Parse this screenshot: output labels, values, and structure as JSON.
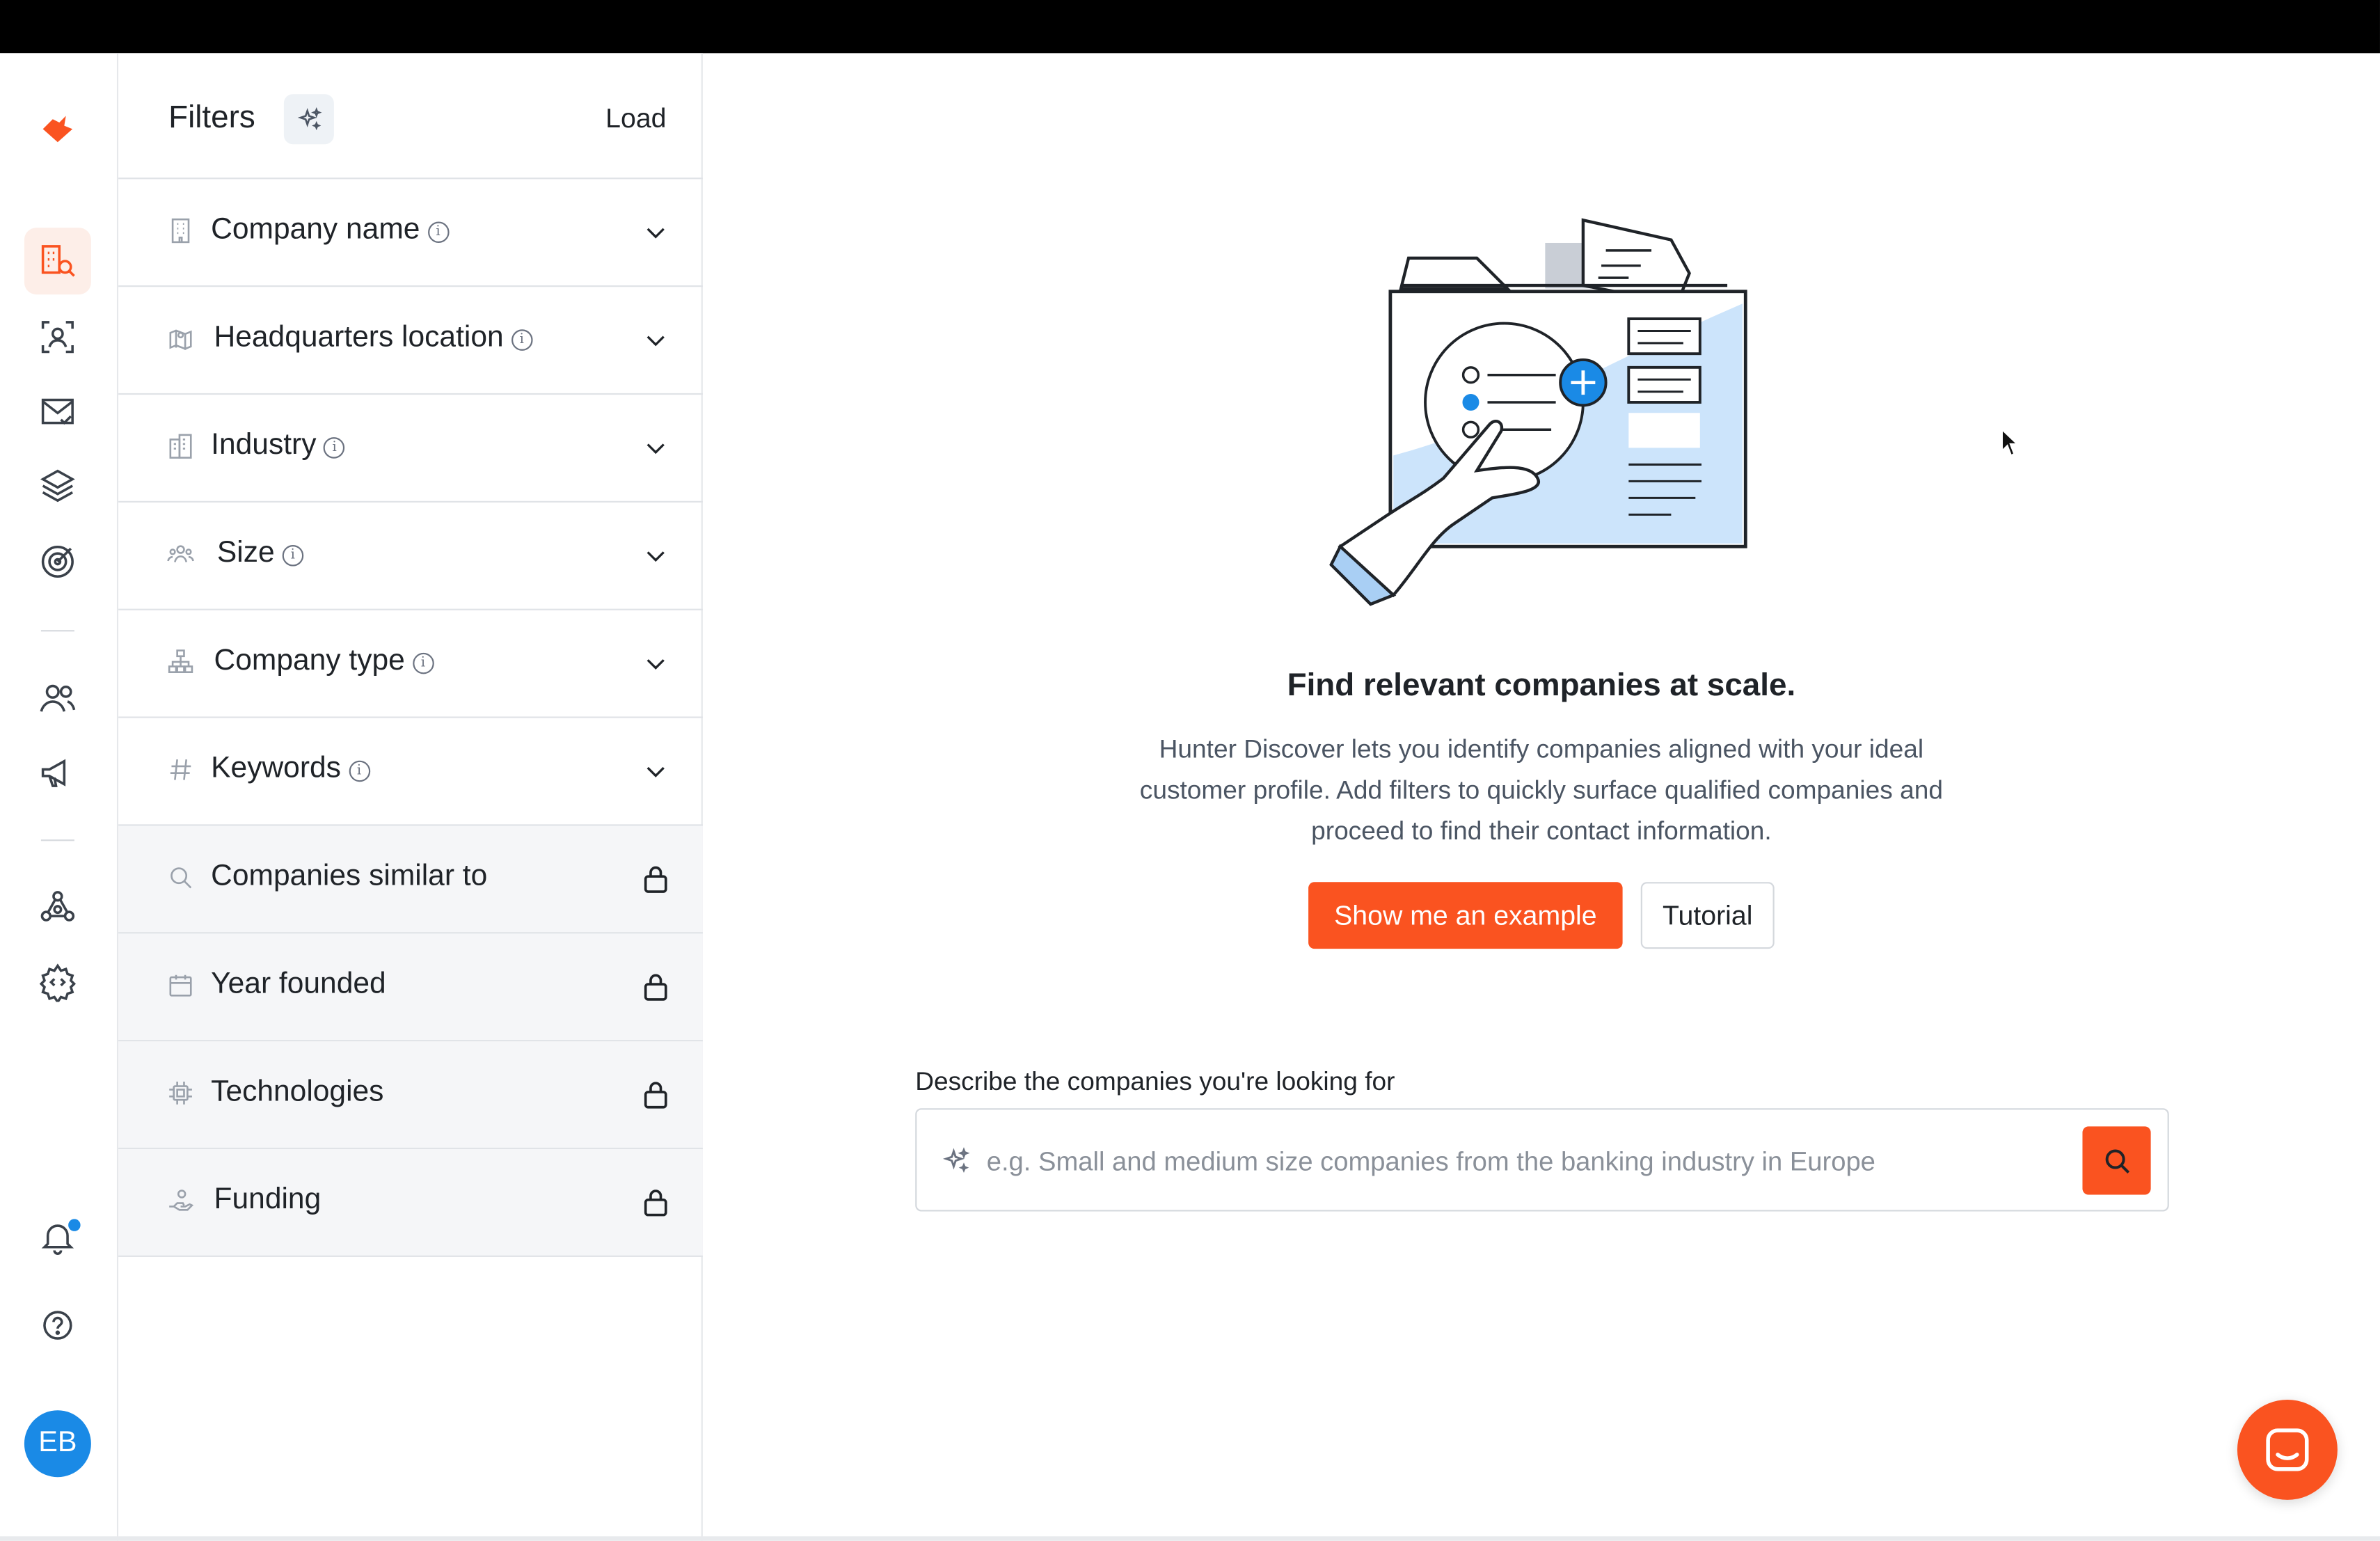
{
  "brand": {
    "logo": "hunter-fox-logo",
    "accent": "#fa5320",
    "link_blue": "#1a8ae6"
  },
  "rail": {
    "items": [
      {
        "name": "discover",
        "icon": "building-search-icon",
        "active": true
      },
      {
        "name": "domain-search",
        "icon": "person-frame-icon"
      },
      {
        "name": "email-verifier",
        "icon": "mail-check-icon"
      },
      {
        "name": "bulks",
        "icon": "layers-icon"
      },
      {
        "name": "campaigns-target",
        "icon": "target-icon"
      },
      {
        "name": "leads",
        "icon": "users-icon"
      },
      {
        "name": "campaigns",
        "icon": "megaphone-icon"
      },
      {
        "name": "integrations",
        "icon": "network-icon"
      },
      {
        "name": "api",
        "icon": "gear-code-icon"
      }
    ],
    "notifications_icon": "bell-icon",
    "help_icon": "question-circle-icon",
    "avatar_initials": "EB"
  },
  "filters": {
    "title": "Filters",
    "ai_icon": "sparkles-icon",
    "load_label": "Load",
    "items": [
      {
        "label": "Company name",
        "icon": "building-icon",
        "info": true,
        "locked": false
      },
      {
        "label": "Headquarters location",
        "icon": "map-icon",
        "info": true,
        "locked": false
      },
      {
        "label": "Industry",
        "icon": "buildings-icon",
        "info": true,
        "locked": false
      },
      {
        "label": "Size",
        "icon": "people-icon",
        "info": true,
        "locked": false
      },
      {
        "label": "Company type",
        "icon": "org-chart-icon",
        "info": true,
        "locked": false
      },
      {
        "label": "Keywords",
        "icon": "hash-icon",
        "info": true,
        "locked": false
      },
      {
        "label": "Companies similar to",
        "icon": "search-icon",
        "info": false,
        "locked": true
      },
      {
        "label": "Year founded",
        "icon": "calendar-icon",
        "info": false,
        "locked": true
      },
      {
        "label": "Technologies",
        "icon": "chip-icon",
        "info": false,
        "locked": true
      },
      {
        "label": "Funding",
        "icon": "hand-coin-icon",
        "info": false,
        "locked": true
      }
    ]
  },
  "main": {
    "headline": "Find relevant companies at scale.",
    "description": "Hunter Discover lets you identify companies aligned with your ideal customer profile. Add filters to quickly surface qualified companies and proceed to find their contact information.",
    "primary_button": "Show me an example",
    "secondary_button": "Tutorial",
    "query_label": "Describe the companies you're looking for",
    "query_placeholder": "e.g. Small and medium size companies from the banking industry in Europe",
    "query_value": ""
  },
  "chat_icon": "chat-bubble-icon"
}
